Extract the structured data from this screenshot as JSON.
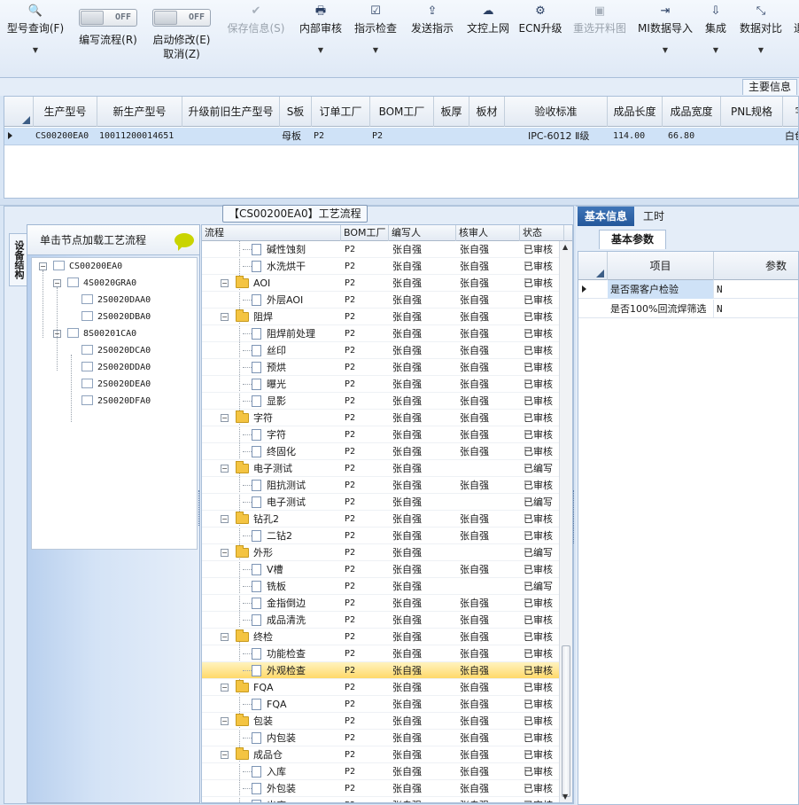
{
  "toolbar": {
    "items": [
      {
        "icon": "search-icon",
        "glyph": "🔍",
        "label": "型号查询(F)",
        "arrow": "▼"
      },
      {
        "icon": "toggle",
        "toggle_text": "OFF",
        "label": "编写流程(R)"
      },
      {
        "icon": "toggle",
        "toggle_text": "OFF",
        "label": "启动修改(E)",
        "sub": "取消(Z)"
      },
      {
        "icon": "check-icon",
        "glyph": "✔",
        "label": "保存信息(S)",
        "disabled": true
      },
      {
        "icon": "printer-icon",
        "glyph": "🖶",
        "label": "内部审核",
        "arrow": "▼"
      },
      {
        "icon": "checkbox-icon",
        "glyph": "☑",
        "label": "指示检查",
        "arrow": "▼"
      },
      {
        "icon": "upload-icon",
        "glyph": "⇪",
        "label": "发送指示"
      },
      {
        "icon": "cloud-upload-icon",
        "glyph": "☁",
        "label": "文控上网"
      },
      {
        "icon": "ecn-icon",
        "glyph": "⚙",
        "label": "ECN升级"
      },
      {
        "icon": "image-icon",
        "glyph": "▣",
        "label": "重选开料图",
        "disabled": true
      },
      {
        "icon": "import-icon",
        "glyph": "⇥",
        "label": "MI数据导入",
        "arrow": "▼"
      },
      {
        "icon": "download-icon",
        "glyph": "⇩",
        "label": "集成",
        "arrow": "▼"
      },
      {
        "icon": "compare-icon",
        "glyph": "⤡",
        "label": "数据对比",
        "arrow": "▼"
      },
      {
        "icon": "more-icon",
        "glyph": "",
        "label": "退"
      }
    ]
  },
  "main_tab": "主要信息",
  "product_grid": {
    "columns": [
      "生产型号",
      "新生产型号",
      "升级前旧生产型号",
      "S板",
      "订单工厂",
      "BOM工厂",
      "板厚",
      "板材",
      "验收标准",
      "成品长度",
      "成品宽度",
      "PNL规格",
      "字"
    ],
    "row": [
      "CS00200EA0",
      "10011200014651",
      "",
      "母板",
      "P2",
      "P2",
      "",
      "",
      "IPC-6012 Ⅱ级",
      "114.00",
      "66.80",
      "",
      "白色"
    ]
  },
  "flow_title": "【CS00200EA0】工艺流程",
  "side_tab": "设备结构",
  "struct": {
    "header": "单击节点加载工艺流程",
    "nodes": [
      {
        "label": "CS00200EA0",
        "level": 0,
        "pm": "−"
      },
      {
        "label": "4S0020GRA0",
        "level": 1,
        "pm": "−"
      },
      {
        "label": "2S0020DAA0",
        "level": 2
      },
      {
        "label": "2S0020DBA0",
        "level": 2
      },
      {
        "label": "8S00201CA0",
        "level": 1,
        "pm": "−"
      },
      {
        "label": "2S0020DCA0",
        "level": 2
      },
      {
        "label": "2S0020DDA0",
        "level": 2
      },
      {
        "label": "2S0020DEA0",
        "level": 2
      },
      {
        "label": "2S0020DFA0",
        "level": 2
      }
    ]
  },
  "process_grid": {
    "columns": [
      "流程",
      "BOM工厂",
      "编写人",
      "核审人",
      "状态"
    ],
    "rows": [
      {
        "name": "碱性蚀刻",
        "group": false,
        "bom": "P2",
        "writer": "张自强",
        "reviewer": "张自强",
        "status": "已审核"
      },
      {
        "name": "水洗烘干",
        "group": false,
        "bom": "P2",
        "writer": "张自强",
        "reviewer": "张自强",
        "status": "已审核"
      },
      {
        "name": "AOI",
        "group": true,
        "bom": "P2",
        "writer": "张自强",
        "reviewer": "张自强",
        "status": "已审核"
      },
      {
        "name": "外层AOI",
        "group": false,
        "bom": "P2",
        "writer": "张自强",
        "reviewer": "张自强",
        "status": "已审核"
      },
      {
        "name": "阻焊",
        "group": true,
        "bom": "P2",
        "writer": "张自强",
        "reviewer": "张自强",
        "status": "已审核"
      },
      {
        "name": "阻焊前处理",
        "group": false,
        "bom": "P2",
        "writer": "张自强",
        "reviewer": "张自强",
        "status": "已审核"
      },
      {
        "name": "丝印",
        "group": false,
        "bom": "P2",
        "writer": "张自强",
        "reviewer": "张自强",
        "status": "已审核"
      },
      {
        "name": "预烘",
        "group": false,
        "bom": "P2",
        "writer": "张自强",
        "reviewer": "张自强",
        "status": "已审核"
      },
      {
        "name": "曝光",
        "group": false,
        "bom": "P2",
        "writer": "张自强",
        "reviewer": "张自强",
        "status": "已审核"
      },
      {
        "name": "显影",
        "group": false,
        "bom": "P2",
        "writer": "张自强",
        "reviewer": "张自强",
        "status": "已审核"
      },
      {
        "name": "字符",
        "group": true,
        "bom": "P2",
        "writer": "张自强",
        "reviewer": "张自强",
        "status": "已审核"
      },
      {
        "name": "字符",
        "group": false,
        "bom": "P2",
        "writer": "张自强",
        "reviewer": "张自强",
        "status": "已审核"
      },
      {
        "name": "终固化",
        "group": false,
        "bom": "P2",
        "writer": "张自强",
        "reviewer": "张自强",
        "status": "已审核"
      },
      {
        "name": "电子测试",
        "group": true,
        "bom": "P2",
        "writer": "张自强",
        "reviewer": "",
        "status": "已编写"
      },
      {
        "name": "阻抗测试",
        "group": false,
        "bom": "P2",
        "writer": "张自强",
        "reviewer": "张自强",
        "status": "已审核"
      },
      {
        "name": "电子测试",
        "group": false,
        "bom": "P2",
        "writer": "张自强",
        "reviewer": "",
        "status": "已编写"
      },
      {
        "name": "钻孔2",
        "group": true,
        "bom": "P2",
        "writer": "张自强",
        "reviewer": "张自强",
        "status": "已审核"
      },
      {
        "name": "二钻2",
        "group": false,
        "bom": "P2",
        "writer": "张自强",
        "reviewer": "张自强",
        "status": "已审核"
      },
      {
        "name": "外形",
        "group": true,
        "bom": "P2",
        "writer": "张自强",
        "reviewer": "",
        "status": "已编写"
      },
      {
        "name": "V槽",
        "group": false,
        "bom": "P2",
        "writer": "张自强",
        "reviewer": "张自强",
        "status": "已审核"
      },
      {
        "name": "铣板",
        "group": false,
        "bom": "P2",
        "writer": "张自强",
        "reviewer": "",
        "status": "已编写"
      },
      {
        "name": "金指倒边",
        "group": false,
        "bom": "P2",
        "writer": "张自强",
        "reviewer": "张自强",
        "status": "已审核"
      },
      {
        "name": "成品清洗",
        "group": false,
        "bom": "P2",
        "writer": "张自强",
        "reviewer": "张自强",
        "status": "已审核"
      },
      {
        "name": "终检",
        "group": true,
        "bom": "P2",
        "writer": "张自强",
        "reviewer": "张自强",
        "status": "已审核"
      },
      {
        "name": "功能检查",
        "group": false,
        "bom": "P2",
        "writer": "张自强",
        "reviewer": "张自强",
        "status": "已审核"
      },
      {
        "name": "外观检查",
        "group": false,
        "bom": "P2",
        "writer": "张自强",
        "reviewer": "张自强",
        "status": "已审核",
        "selected": true
      },
      {
        "name": "FQA",
        "group": true,
        "bom": "P2",
        "writer": "张自强",
        "reviewer": "张自强",
        "status": "已审核"
      },
      {
        "name": "FQA",
        "group": false,
        "bom": "P2",
        "writer": "张自强",
        "reviewer": "张自强",
        "status": "已审核"
      },
      {
        "name": "包装",
        "group": true,
        "bom": "P2",
        "writer": "张自强",
        "reviewer": "张自强",
        "status": "已审核"
      },
      {
        "name": "内包装",
        "group": false,
        "bom": "P2",
        "writer": "张自强",
        "reviewer": "张自强",
        "status": "已审核"
      },
      {
        "name": "成品仓",
        "group": true,
        "bom": "P2",
        "writer": "张自强",
        "reviewer": "张自强",
        "status": "已审核"
      },
      {
        "name": "入库",
        "group": false,
        "bom": "P2",
        "writer": "张自强",
        "reviewer": "张自强",
        "status": "已审核"
      },
      {
        "name": "外包装",
        "group": false,
        "bom": "P2",
        "writer": "张自强",
        "reviewer": "张自强",
        "status": "已审核"
      },
      {
        "name": "出库",
        "group": false,
        "bom": "P2",
        "writer": "张自强",
        "reviewer": "张自强",
        "status": "已审核"
      }
    ]
  },
  "right_panel": {
    "tabs": [
      "基本信息",
      "工时"
    ],
    "subtab": "基本参数",
    "columns": [
      "项目",
      "参数"
    ],
    "rows": [
      {
        "item": "是否需客户检验",
        "value": "N",
        "selected": true
      },
      {
        "item": "是否100%回流焊筛选",
        "value": "N"
      }
    ]
  },
  "colors": {
    "accent": "#2a5fa3",
    "selection": "#ffd96a",
    "grid_selection": "#cfe2f7"
  }
}
